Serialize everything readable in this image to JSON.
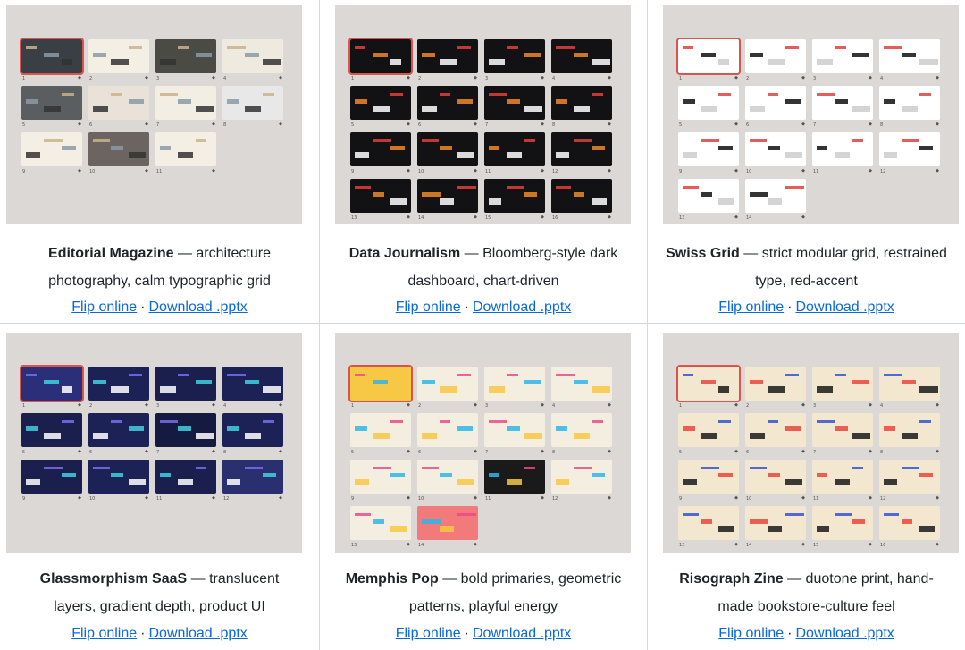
{
  "templates": [
    {
      "name": "Editorial Magazine",
      "desc": "— architecture photography, calm typographic grid",
      "flip_label": "Flip online",
      "download_label": "Download .pptx",
      "theme": {
        "bg": "#dcd8d6",
        "slides": [
          "#3a3f45",
          "#f3efe4",
          "#4b4b45",
          "#eeeae0",
          "#5a5e60",
          "#eae2d8",
          "#f2eee4",
          "#e8e8e8",
          "#f3efe4",
          "#6b6460",
          "#f3efe4"
        ]
      },
      "slide_count": 11
    },
    {
      "name": "Data Journalism",
      "desc": "— Bloomberg-style dark dashboard, chart-driven",
      "flip_label": "Flip online",
      "download_label": "Download .pptx",
      "theme": {
        "bg": "#dcd8d6",
        "slides": [
          "#121215",
          "#121215",
          "#121215",
          "#121215",
          "#121215",
          "#121215",
          "#121215",
          "#121215",
          "#121215",
          "#121215",
          "#121215",
          "#121215",
          "#121215",
          "#121215",
          "#121215",
          "#121215"
        ]
      },
      "slide_count": 16
    },
    {
      "name": "Swiss Grid",
      "desc": "— strict modular grid, restrained type, red-accent",
      "flip_label": "Flip online",
      "download_label": "Download .pptx",
      "theme": {
        "bg": "#dcd8d6",
        "slides": [
          "#ffffff",
          "#ffffff",
          "#ffffff",
          "#ffffff",
          "#ffffff",
          "#ffffff",
          "#ffffff",
          "#ffffff",
          "#ffffff",
          "#ffffff",
          "#ffffff",
          "#ffffff",
          "#ffffff",
          "#ffffff"
        ]
      },
      "slide_count": 14
    },
    {
      "name": "Glassmorphism SaaS",
      "desc": "— translucent layers, gradient depth, product UI",
      "flip_label": "Flip online",
      "download_label": "Download .pptx",
      "theme": {
        "bg": "#dcd8d6",
        "slides": [
          "#2b2f7a",
          "#1d2256",
          "#1a1f4d",
          "#1d2256",
          "#1a1f4d",
          "#1d2256",
          "#141a40",
          "#1d2256",
          "#1a1f4d",
          "#1d2256",
          "#1a1f4d",
          "#2a2f70"
        ]
      },
      "slide_count": 12
    },
    {
      "name": "Memphis Pop",
      "desc": "— bold primaries, geometric patterns, playful energy",
      "flip_label": "Flip online",
      "download_label": "Download .pptx",
      "theme": {
        "bg": "#dcd8d6",
        "slides": [
          "#f7c843",
          "#f4eee0",
          "#f4eee0",
          "#f4eee0",
          "#f4eee0",
          "#f4eee0",
          "#f4eee0",
          "#f4eee0",
          "#f4eee0",
          "#f4eee0",
          "#1a1a1a",
          "#f4eee0",
          "#f4eee0",
          "#f27a7a"
        ]
      },
      "slide_count": 14
    },
    {
      "name": "Risograph Zine",
      "desc": "— duotone print, hand-made bookstore-culture feel",
      "flip_label": "Flip online",
      "download_label": "Download .pptx",
      "theme": {
        "bg": "#dcd8d6",
        "slides": [
          "#f3e7cf",
          "#f3e7cf",
          "#f3e7cf",
          "#f3e7cf",
          "#f3e7cf",
          "#f3e7cf",
          "#f3e7cf",
          "#f3e7cf",
          "#f3e7cf",
          "#f3e7cf",
          "#f3e7cf",
          "#f3e7cf",
          "#f3e7cf",
          "#f3e7cf",
          "#f3e7cf",
          "#f3e7cf"
        ]
      },
      "slide_count": 16
    }
  ]
}
